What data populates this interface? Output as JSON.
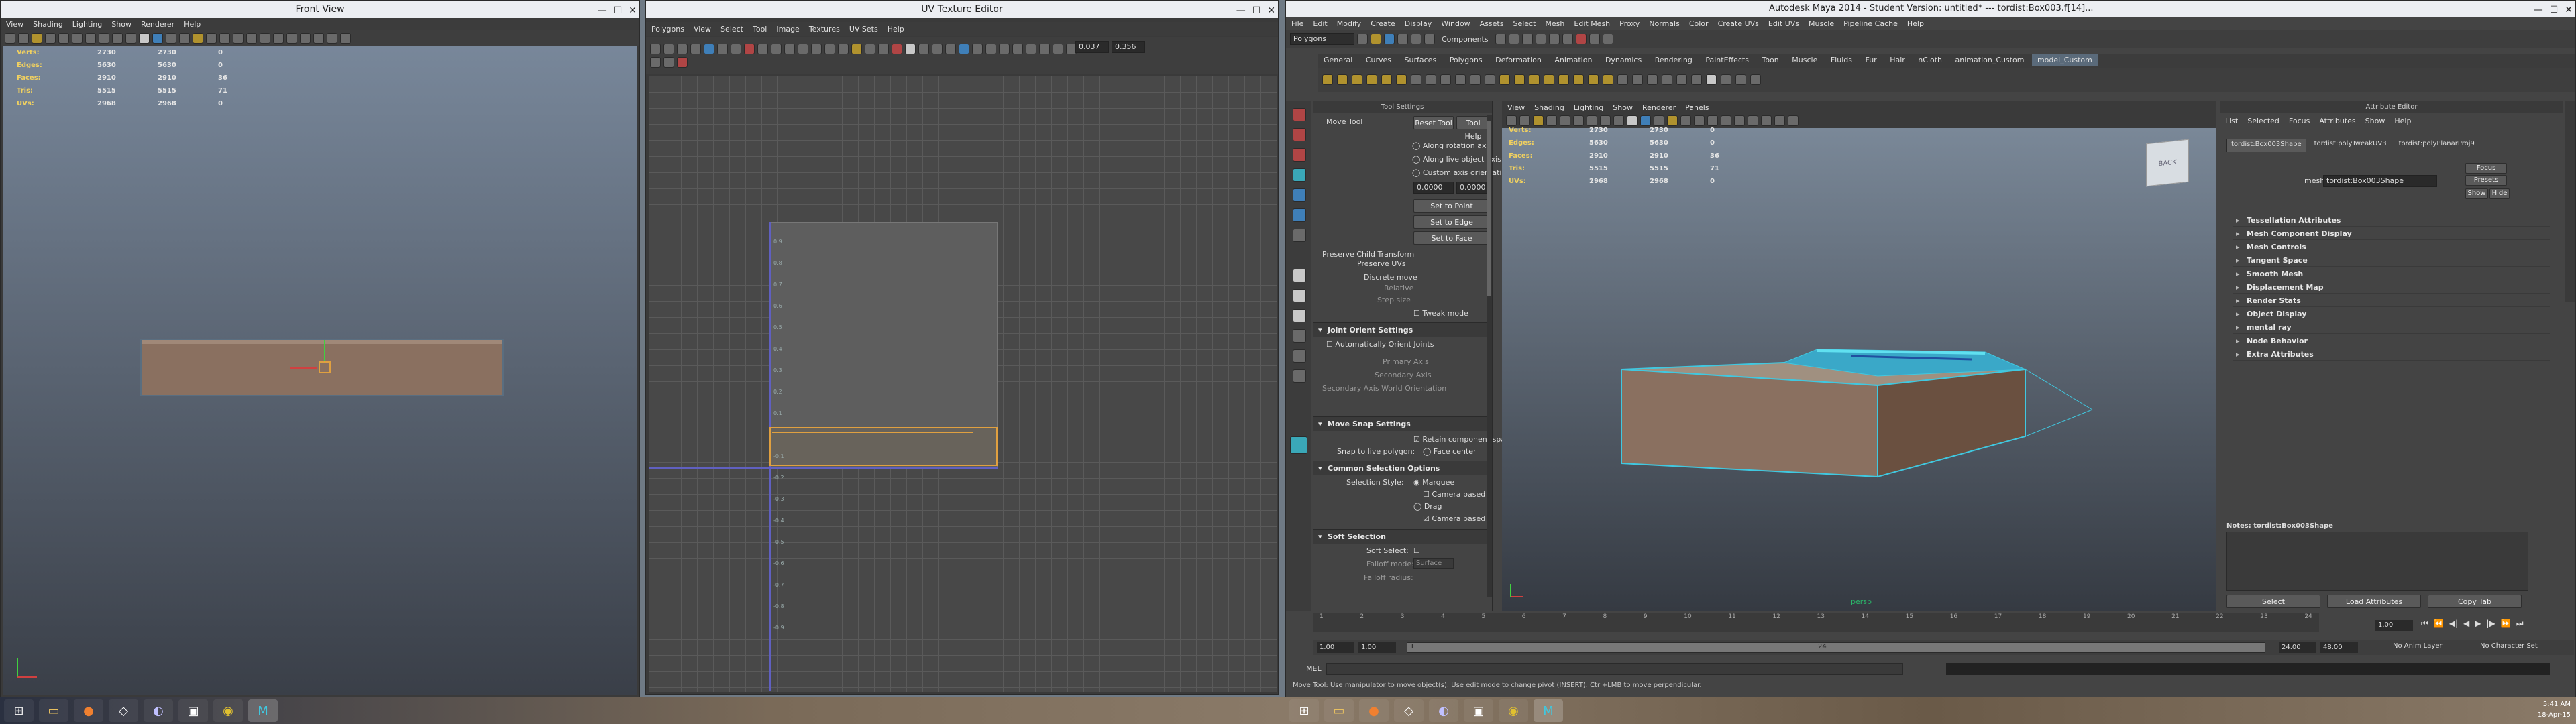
{
  "front_view": {
    "title": "Front View",
    "menu": [
      "View",
      "Shading",
      "Lighting",
      "Show",
      "Renderer",
      "Help"
    ],
    "hud": [
      {
        "k": "Verts:",
        "a": "2730",
        "b": "2730",
        "c": "0"
      },
      {
        "k": "Edges:",
        "a": "5630",
        "b": "5630",
        "c": "0"
      },
      {
        "k": "Faces:",
        "a": "2910",
        "b": "2910",
        "c": "36"
      },
      {
        "k": "Tris:",
        "a": "5515",
        "b": "5515",
        "c": "71"
      },
      {
        "k": "UVs:",
        "a": "2968",
        "b": "2968",
        "c": "0"
      }
    ]
  },
  "uv_editor": {
    "title": "UV Texture Editor",
    "menu": [
      "Polygons",
      "View",
      "Select",
      "Tool",
      "Image",
      "Textures",
      "UV Sets",
      "Help"
    ],
    "field1": "0.037",
    "field2": "0.356",
    "axis_labels": [
      "0.9",
      "0.8",
      "0.7",
      "0.6",
      "0.5",
      "0.4",
      "0.3",
      "0.2",
      "0.1",
      "-0.1",
      "-0.2",
      "-0.3",
      "-0.4",
      "-0.5",
      "-0.6",
      "-0.7",
      "-0.8",
      "-0.9"
    ]
  },
  "maya": {
    "title": "Autodesk Maya 2014 - Student Version: untitled*   ---   tordist:Box003.f[14]...",
    "menu": [
      "File",
      "Edit",
      "Modify",
      "Create",
      "Display",
      "Window",
      "Assets",
      "Select",
      "Mesh",
      "Edit Mesh",
      "Proxy",
      "Normals",
      "Color",
      "Create UVs",
      "Edit UVs",
      "Muscle",
      "Pipeline Cache",
      "Help"
    ],
    "mode_dropdown": "Polygons",
    "components_label": "Components",
    "shelf_tabs": [
      "General",
      "Curves",
      "Surfaces",
      "Polygons",
      "Deformation",
      "Animation",
      "Dynamics",
      "Rendering",
      "PaintEffects",
      "Toon",
      "Muscle",
      "Fluids",
      "Fur",
      "Hair",
      "nCloth",
      "animation_Custom",
      "model_Custom"
    ],
    "tool_settings": {
      "header": "Tool Settings",
      "tool_name": "Move Tool",
      "reset_button": "Reset Tool",
      "help_button": "Tool Help",
      "options": [
        "Along rotation axis",
        "Along live object axis",
        "Custom axis orientation"
      ],
      "custom_value": "0.0000",
      "set_buttons": [
        "Set to Point",
        "Set to Edge",
        "Set to Face"
      ],
      "preserve_child": "Preserve Child Transform",
      "preserve_uvs": "Preserve UVs",
      "discrete_move": "Discrete move",
      "relative": "Relative",
      "step_size": "Step size",
      "tweak_mode": "Tweak mode",
      "joint_orient": "Joint Orient Settings",
      "auto_orient": "Automatically Orient Joints",
      "primary_axis": "Primary Axis",
      "secondary_axis": "Secondary Axis",
      "secondary_world": "Secondary Axis World Orientation",
      "move_snap": "Move Snap Settings",
      "retain_component": "Retain component spacing",
      "snap_live_polygon": "Snap to live polygon:",
      "face_center": "Face center",
      "common_selection": "Common Selection Options",
      "selection_style": "Selection Style:",
      "marquee": "Marquee",
      "camera_based1": "Camera based",
      "drag": "Drag",
      "camera_based2": "Camera based",
      "soft_selection": "Soft Selection",
      "soft_select": "Soft Select:",
      "falloff_mode": "Falloff mode:",
      "falloff_mode_value": "Surface",
      "falloff_radius": "Falloff radius:"
    },
    "viewport": {
      "menu": [
        "View",
        "Shading",
        "Lighting",
        "Show",
        "Renderer",
        "Panels"
      ],
      "hud": [
        {
          "k": "Verts:",
          "a": "2730",
          "b": "2730",
          "c": "0"
        },
        {
          "k": "Edges:",
          "a": "5630",
          "b": "5630",
          "c": "0"
        },
        {
          "k": "Faces:",
          "a": "2910",
          "b": "2910",
          "c": "36"
        },
        {
          "k": "Tris:",
          "a": "5515",
          "b": "5515",
          "c": "71"
        },
        {
          "k": "UVs:",
          "a": "2968",
          "b": "2968",
          "c": "0"
        }
      ],
      "viewcube": "BACK",
      "persp_label": "persp"
    },
    "attribute_editor": {
      "header": "Attribute Editor",
      "menu": [
        "List",
        "Selected",
        "Focus",
        "Attributes",
        "Show",
        "Help"
      ],
      "tabs": [
        "tordist:Box003Shape",
        "tordist:polyTweakUV3",
        "tordist:polyPlanarProj9"
      ],
      "focus_button": "Focus",
      "presets_button": "Presets",
      "show_button": "Show",
      "hide_button": "Hide",
      "mesh_label": "mesh:",
      "mesh_value": "tordist:Box003Shape",
      "sections": [
        "Tessellation Attributes",
        "Mesh Component Display",
        "Mesh Controls",
        "Tangent Space",
        "Smooth Mesh",
        "Displacement Map",
        "Render Stats",
        "Object Display",
        "mental ray",
        "Node Behavior",
        "Extra Attributes"
      ],
      "notes": "Notes: tordist:Box003Shape",
      "select_button": "Select",
      "load_button": "Load Attributes",
      "copy_button": "Copy Tab"
    },
    "timeline": {
      "ticks": [
        "1",
        "2",
        "3",
        "4",
        "5",
        "6",
        "7",
        "8",
        "9",
        "10",
        "11",
        "12",
        "13",
        "14",
        "15",
        "16",
        "17",
        "18",
        "19",
        "20",
        "21",
        "22",
        "23",
        "24"
      ],
      "current_frame": "1.00",
      "start": "1.00",
      "start2": "1.00",
      "range_start": "1",
      "range_end": "24",
      "end1": "24.00",
      "end2": "48.00",
      "anim_layer": "No Anim Layer",
      "char_set": "No Character Set"
    },
    "mel_label": "MEL",
    "help_line": "Move Tool: Use manipulator to move object(s). Use edit mode to change pivot (INSERT). Ctrl+LMB to move perpendicular."
  },
  "taskbar": {
    "time": "5:41 AM",
    "date": "18-Apr-15"
  },
  "colors": {
    "maya_panel": "#444444",
    "hud_label": "#f0d060",
    "object_brown": "#8a7060",
    "wire_cyan": "#40c8e0",
    "uv_orange": "#e0a040"
  }
}
